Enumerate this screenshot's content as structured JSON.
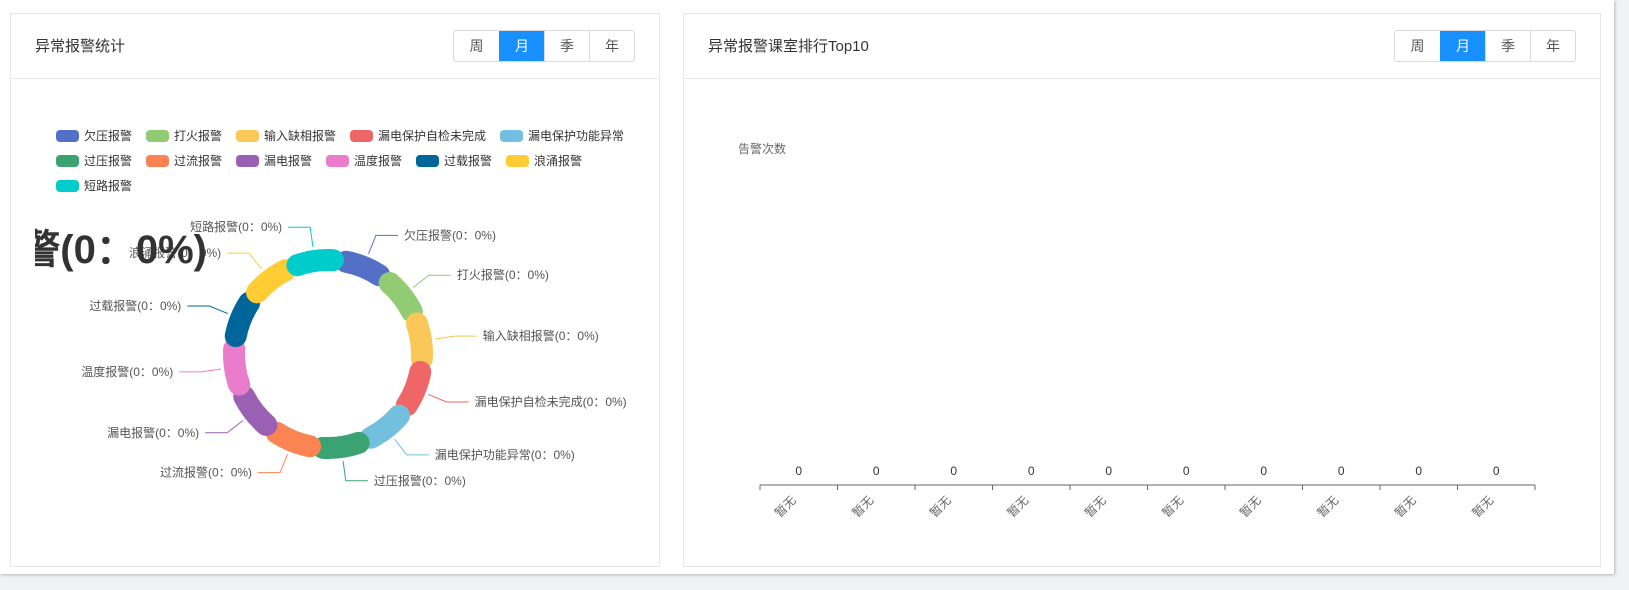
{
  "left_card": {
    "title": "异常报警统计",
    "periods": [
      "周",
      "月",
      "季",
      "年"
    ],
    "active_period": "月"
  },
  "right_card": {
    "title": "异常报警课室排行Top10",
    "periods": [
      "周",
      "月",
      "季",
      "年"
    ],
    "active_period": "月"
  },
  "chart_data": [
    {
      "type": "pie",
      "subtype": "rose-ring",
      "legend_position": "top",
      "slice_label_format": "{name}(0：0%)",
      "highlight_label": "警(0：0%)",
      "slices": [
        {
          "name": "欠压报警",
          "value": 0,
          "percent": 0,
          "color": "#5470c6"
        },
        {
          "name": "打火报警",
          "value": 0,
          "percent": 0,
          "color": "#91cc75"
        },
        {
          "name": "输入缺相报警",
          "value": 0,
          "percent": 0,
          "color": "#fac858"
        },
        {
          "name": "漏电保护自检未完成",
          "value": 0,
          "percent": 0,
          "color": "#ee6666"
        },
        {
          "name": "漏电保护功能异常",
          "value": 0,
          "percent": 0,
          "color": "#73c0de"
        },
        {
          "name": "过压报警",
          "value": 0,
          "percent": 0,
          "color": "#3ba272"
        },
        {
          "name": "过流报警",
          "value": 0,
          "percent": 0,
          "color": "#fc8452"
        },
        {
          "name": "漏电报警",
          "value": 0,
          "percent": 0,
          "color": "#9a60b4"
        },
        {
          "name": "温度报警",
          "value": 0,
          "percent": 0,
          "color": "#ea7ccc"
        },
        {
          "name": "过载报警",
          "value": 0,
          "percent": 0,
          "color": "#006699"
        },
        {
          "name": "浪涌报警",
          "value": 0,
          "percent": 0,
          "color": "#ffcc33"
        },
        {
          "name": "短路报警",
          "value": 0,
          "percent": 0,
          "color": "#00cccc"
        }
      ]
    },
    {
      "type": "bar",
      "ylabel": "告警次数",
      "categories": [
        "暂无",
        "暂无",
        "暂无",
        "暂无",
        "暂无",
        "暂无",
        "暂无",
        "暂无",
        "暂无",
        "暂无"
      ],
      "values": [
        0,
        0,
        0,
        0,
        0,
        0,
        0,
        0,
        0,
        0
      ],
      "grid": false
    }
  ]
}
